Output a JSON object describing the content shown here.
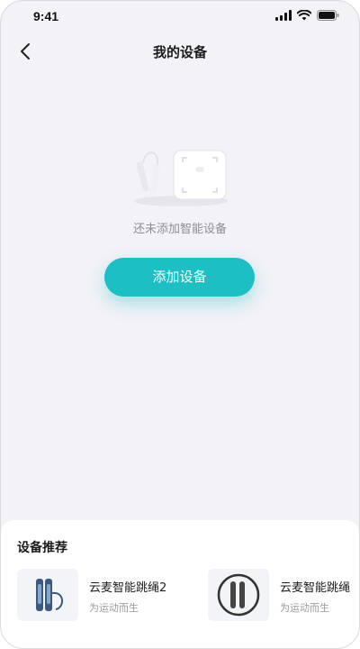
{
  "status_bar": {
    "time": "9:41"
  },
  "nav": {
    "title": "我的设备"
  },
  "empty_state": {
    "message": "还未添加智能设备",
    "add_button_label": "添加设备"
  },
  "recommend": {
    "title": "设备推荐",
    "items": [
      {
        "name": "云麦智能跳绳2",
        "desc": "为运动而生"
      },
      {
        "name": "云麦智能跳绳",
        "desc": "为运动而生"
      }
    ]
  },
  "colors": {
    "accent": "#1bbfc4",
    "background": "#f2f2f7"
  }
}
